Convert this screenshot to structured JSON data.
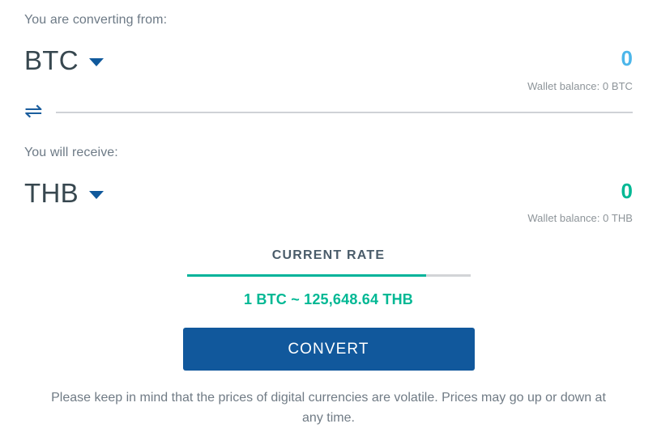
{
  "from": {
    "label": "You are converting from:",
    "currency": "BTC",
    "caret_icon": "chevron-down-icon",
    "amount": "0",
    "amount_placeholder": "0",
    "amount_color": "#4cb6ea",
    "wallet_balance": "Wallet balance: 0 BTC"
  },
  "swap": {
    "icon": "swap-arrows-icon",
    "glyph": "⇌"
  },
  "to": {
    "label": "You will receive:",
    "currency": "THB",
    "caret_icon": "chevron-down-icon",
    "amount": "0",
    "amount_placeholder": "0",
    "amount_color": "#00b894",
    "wallet_balance": "Wallet balance: 0 THB"
  },
  "rate": {
    "title": "CURRENT RATE",
    "value": "1 BTC ~ 125,648.64 THB",
    "progress_percent": 84.5,
    "accent_color": "#00b39a"
  },
  "actions": {
    "convert_label": "CONVERT",
    "convert_color": "#11589c"
  },
  "disclaimer": {
    "text": "Please keep in mind that the prices of digital currencies are volatile. Prices may go up or down at any time."
  }
}
